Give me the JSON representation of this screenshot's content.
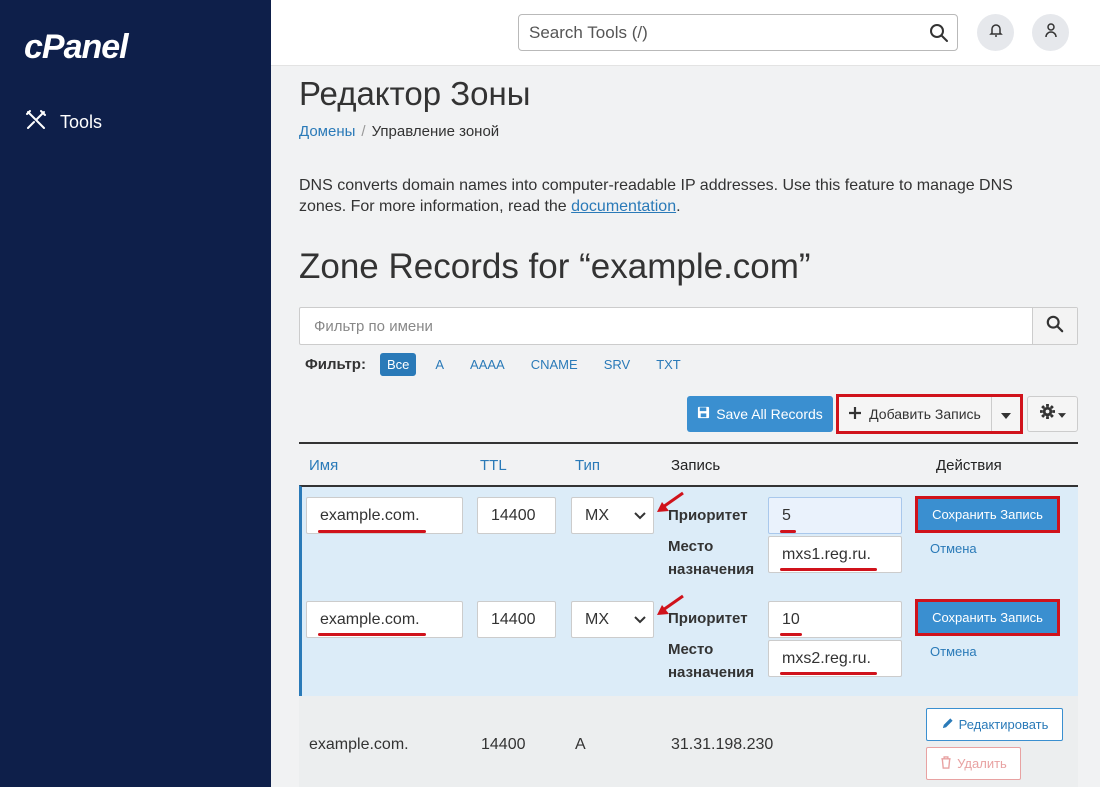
{
  "sidebar": {
    "logo": "cPanel",
    "tools_label": "Tools"
  },
  "topbar": {
    "search_placeholder": "Search Tools (/)"
  },
  "page": {
    "title": "Редактор Зоны",
    "breadcrumb": [
      "Домены",
      "Управление зоной"
    ],
    "description_before_link": "DNS converts domain names into computer-readable IP addresses. Use this feature to manage DNS zones. For more information, read the ",
    "description_link": "documentation",
    "description_after_link": ".",
    "section_title": "Zone Records for “example.com”"
  },
  "filter": {
    "placeholder": "Фильтр по имени",
    "label": "Фильтр:",
    "options": [
      "Все",
      "A",
      "AAAA",
      "CNAME",
      "SRV",
      "TXT"
    ],
    "active": "Все"
  },
  "toolbar": {
    "save_all_label": "Save All Records",
    "add_record_label": "Добавить Запись"
  },
  "table": {
    "headers": [
      "Имя",
      "TTL",
      "Тип",
      "Запись",
      "Действия"
    ],
    "edit_rows": [
      {
        "name": "example.com.",
        "ttl": "14400",
        "type": "MX",
        "priority_label": "Приоритет",
        "priority": "5",
        "destination_label": "Место назначения",
        "destination": "mxs1.reg.ru.",
        "save_label": "Сохранить Запись",
        "cancel_label": "Отмена"
      },
      {
        "name": "example.com.",
        "ttl": "14400",
        "type": "MX",
        "priority_label": "Приоритет",
        "priority": "10",
        "destination_label": "Место назначения",
        "destination": "mxs2.reg.ru.",
        "save_label": "Сохранить Запись",
        "cancel_label": "Отмена"
      }
    ],
    "static_rows": [
      {
        "name": "example.com.",
        "ttl": "14400",
        "type": "A",
        "record": "31.31.198.230",
        "edit_label": "Редактировать",
        "delete_label": "Удалить"
      }
    ]
  },
  "colors": {
    "sidebar_bg": "#0e1f4a",
    "link_blue": "#2a7ab8",
    "primary_button": "#3a8fd0",
    "highlight_red": "#d0121b",
    "edit_row_bg": "#dcecf8"
  },
  "icons": [
    "tools-icon",
    "search-icon",
    "bell-icon",
    "user-icon",
    "floppy-disk-icon",
    "plus-icon",
    "caret-down-icon",
    "gear-icon",
    "chevron-down-icon",
    "pencil-icon",
    "trash-icon",
    "red-arrow-annotation"
  ]
}
